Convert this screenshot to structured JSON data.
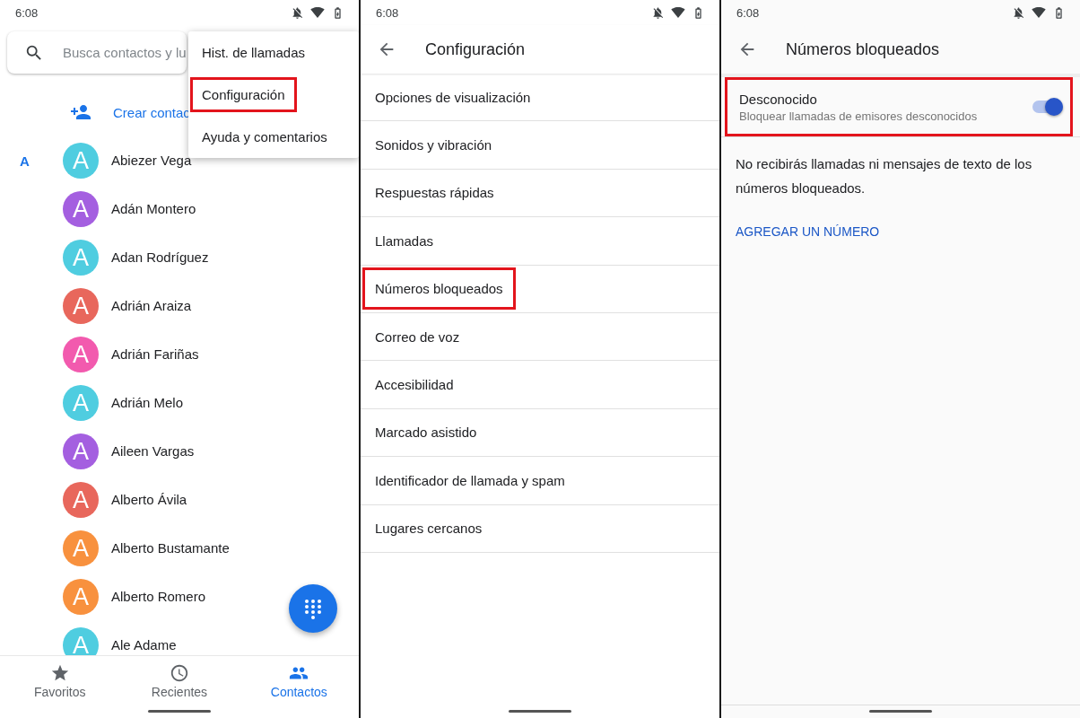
{
  "contacts_screen": {
    "status_bar": {
      "time": "6:08"
    },
    "search": {
      "placeholder": "Busca contactos y lu"
    },
    "create_contact": {
      "label": "Crear contac"
    },
    "section_letter": "A",
    "contacts": [
      {
        "initial": "A",
        "name": "Abiezer Vega",
        "color": "#4fcde0"
      },
      {
        "initial": "A",
        "name": "Adán Montero",
        "color": "#a45fe0"
      },
      {
        "initial": "A",
        "name": "Adan Rodríguez",
        "color": "#4fcde0"
      },
      {
        "initial": "A",
        "name": "Adrián Araiza",
        "color": "#e8675c"
      },
      {
        "initial": "A",
        "name": "Adrián Fariñas",
        "color": "#f25aae"
      },
      {
        "initial": "A",
        "name": "Adrián Melo",
        "color": "#4fcde0"
      },
      {
        "initial": "A",
        "name": "Aileen Vargas",
        "color": "#a45fe0"
      },
      {
        "initial": "A",
        "name": "Alberto Ávila",
        "color": "#e8675c"
      },
      {
        "initial": "A",
        "name": "Alberto Bustamante",
        "color": "#f8913e"
      },
      {
        "initial": "A",
        "name": "Alberto Romero",
        "color": "#f8913e"
      },
      {
        "initial": "A",
        "name": "Ale Adame",
        "color": "#4fcde0"
      }
    ],
    "menu": [
      {
        "label": "Hist. de llamadas",
        "highlighted": false
      },
      {
        "label": "Configuración",
        "highlighted": true
      },
      {
        "label": "Ayuda y comentarios",
        "highlighted": false
      }
    ],
    "bottom_nav": [
      {
        "kind": "star",
        "label": "Favoritos",
        "selected": false
      },
      {
        "kind": "clock",
        "label": "Recientes",
        "selected": false
      },
      {
        "kind": "people",
        "label": "Contactos",
        "selected": true
      }
    ]
  },
  "settings_screen": {
    "status_bar": {
      "time": "6:08"
    },
    "title": "Configuración",
    "items": [
      {
        "label": "Opciones de visualización",
        "highlighted": false
      },
      {
        "label": "Sonidos y vibración",
        "highlighted": false
      },
      {
        "label": "Respuestas rápidas",
        "highlighted": false
      },
      {
        "label": "Llamadas",
        "highlighted": false
      },
      {
        "label": "Números bloqueados",
        "highlighted": true
      },
      {
        "label": "Correo de voz",
        "highlighted": false
      },
      {
        "label": "Accesibilidad",
        "highlighted": false
      },
      {
        "label": "Marcado asistido",
        "highlighted": false
      },
      {
        "label": "Identificador de llamada y spam",
        "highlighted": false
      },
      {
        "label": "Lugares cercanos",
        "highlighted": false
      }
    ]
  },
  "blocked_screen": {
    "status_bar": {
      "time": "6:08"
    },
    "title": "Números bloqueados",
    "setting": {
      "title": "Desconocido",
      "subtitle": "Bloquear llamadas de emisores desconocidos",
      "on": true,
      "highlighted": true
    },
    "note": "No recibirás llamadas ni mensajes de texto de los números bloqueados.",
    "add_link": "AGREGAR UN NÚMERO"
  }
}
